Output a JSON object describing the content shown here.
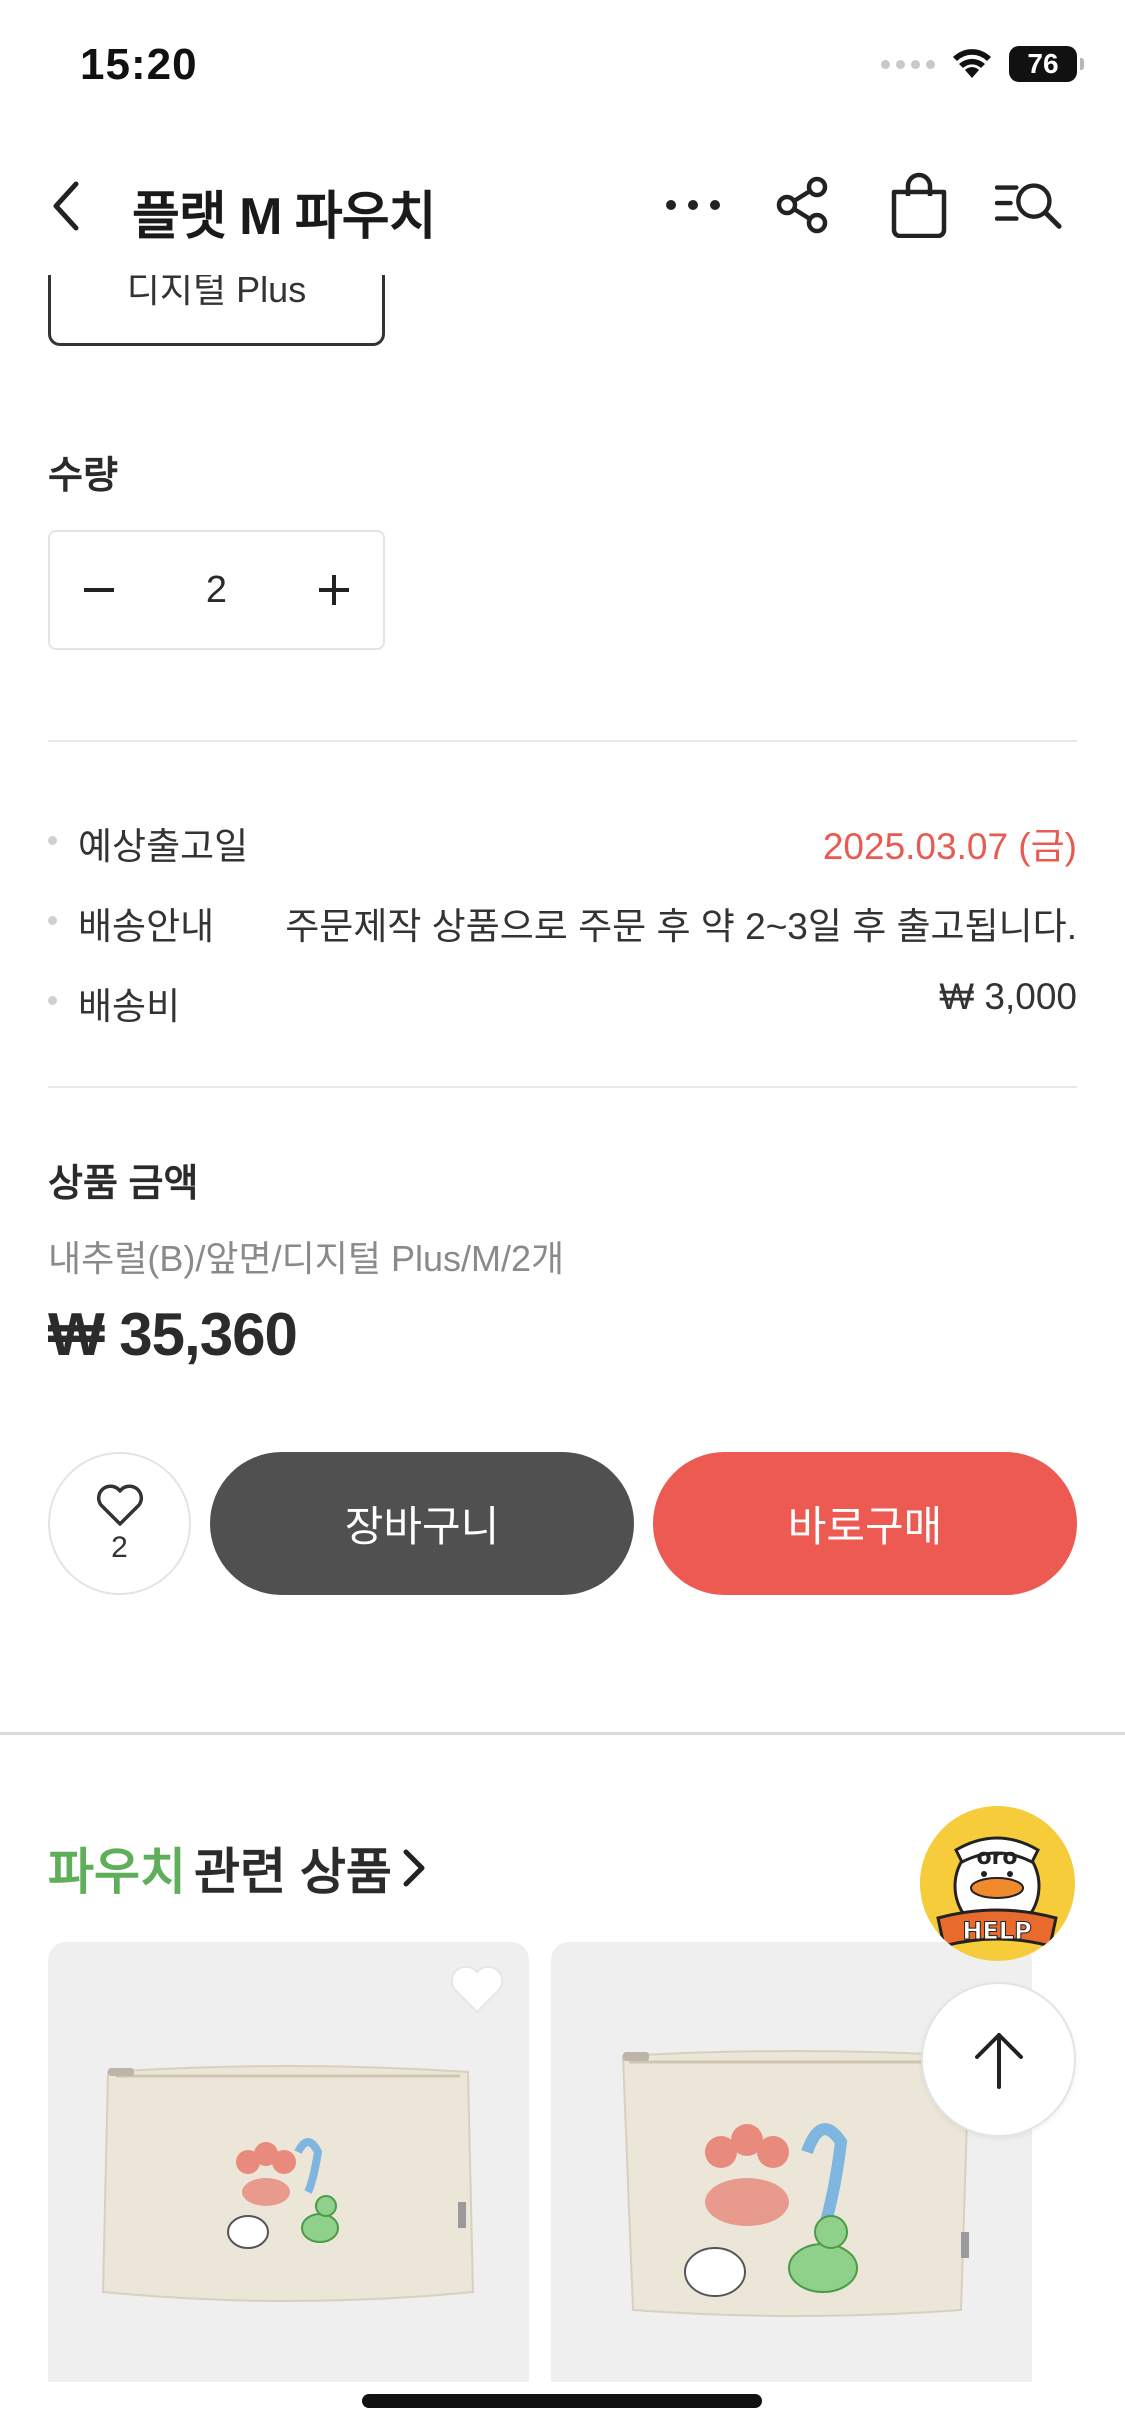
{
  "status_bar": {
    "time": "15:20",
    "battery": "76"
  },
  "nav": {
    "title": "플랫 M 파우치",
    "icons": [
      "chevron-left-icon",
      "more-icon",
      "share-icon",
      "shopping-bag-icon",
      "search-list-icon"
    ]
  },
  "option": {
    "selected_label": "디지털 Plus"
  },
  "quantity": {
    "label": "수량",
    "value": "2",
    "minus": "−",
    "plus": "+"
  },
  "info": {
    "rows": [
      {
        "label": "예상출고일",
        "value": "2025.03.07 (금)",
        "accent": true
      },
      {
        "label": "배송안내",
        "value": "주문제작 상품으로 주문 후 약 2~3일 후 출고됩니다."
      },
      {
        "label": "배송비",
        "value": "₩ 3,000"
      }
    ]
  },
  "price": {
    "label": "상품 금액",
    "options": "내추럴(B)/앞면/디지털 Plus/M/2개",
    "total": "₩ 35,360"
  },
  "actions": {
    "wish_count": "2",
    "cart_label": "장바구니",
    "buy_label": "바로구매"
  },
  "related": {
    "keyword": "파우치",
    "title_rest": "관련 상품"
  },
  "floating": {
    "help_badge": "oro HELP"
  },
  "colors": {
    "accent_red": "#ec5a52",
    "dark_button": "#505050",
    "green_keyword": "#5fae59",
    "help_yellow": "#f6cc3b"
  }
}
